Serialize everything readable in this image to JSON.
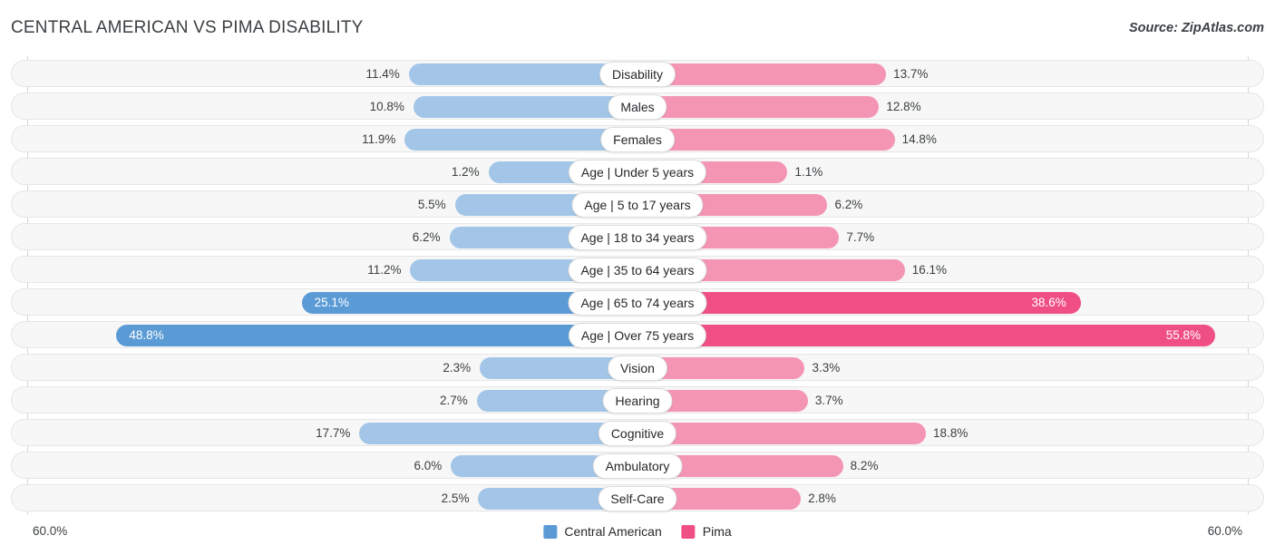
{
  "header": {
    "title": "CENTRAL AMERICAN VS PIMA DISABILITY",
    "source": "Source: ZipAtlas.com"
  },
  "axis": {
    "left_label": "60.0%",
    "right_label": "60.0%",
    "max": 60.0
  },
  "legend": {
    "items": [
      {
        "label": "Central American",
        "color": "#5B9BD5"
      },
      {
        "label": "Pima",
        "color": "#F04F85"
      }
    ]
  },
  "colors": {
    "left_light": "#A3C6E8",
    "left_dark": "#5B9BD5",
    "right_light": "#F595B4",
    "right_dark": "#F04F85",
    "row_track": "#f7f7f7"
  },
  "chart_data": {
    "type": "bar",
    "title": "CENTRAL AMERICAN VS PIMA DISABILITY",
    "subtitle": "Source: ZipAtlas.com",
    "orientation": "horizontal-diverging",
    "xlabel": "",
    "ylabel": "",
    "xlim": [
      60.0,
      60.0
    ],
    "grid": false,
    "legend_position": "bottom-center",
    "categories": [
      "Disability",
      "Males",
      "Females",
      "Age | Under 5 years",
      "Age | 5 to 17 years",
      "Age | 18 to 34 years",
      "Age | 35 to 64 years",
      "Age | 65 to 74 years",
      "Age | Over 75 years",
      "Vision",
      "Hearing",
      "Cognitive",
      "Ambulatory",
      "Self-Care"
    ],
    "series": [
      {
        "name": "Central American",
        "side": "left",
        "values": [
          11.4,
          10.8,
          11.9,
          1.2,
          5.5,
          6.2,
          11.2,
          25.1,
          48.8,
          2.3,
          2.7,
          17.7,
          6.0,
          2.5
        ],
        "labels": [
          "11.4%",
          "10.8%",
          "11.9%",
          "1.2%",
          "5.5%",
          "6.2%",
          "11.2%",
          "25.1%",
          "48.8%",
          "2.3%",
          "2.7%",
          "17.7%",
          "6.0%",
          "2.5%"
        ]
      },
      {
        "name": "Pima",
        "side": "right",
        "values": [
          13.7,
          12.8,
          14.8,
          1.1,
          6.2,
          7.7,
          16.1,
          38.6,
          55.8,
          3.3,
          3.7,
          18.8,
          8.2,
          2.8
        ],
        "labels": [
          "13.7%",
          "12.8%",
          "14.8%",
          "1.1%",
          "6.2%",
          "7.7%",
          "16.1%",
          "38.6%",
          "55.8%",
          "3.3%",
          "3.7%",
          "18.8%",
          "8.2%",
          "2.8%"
        ]
      }
    ]
  }
}
